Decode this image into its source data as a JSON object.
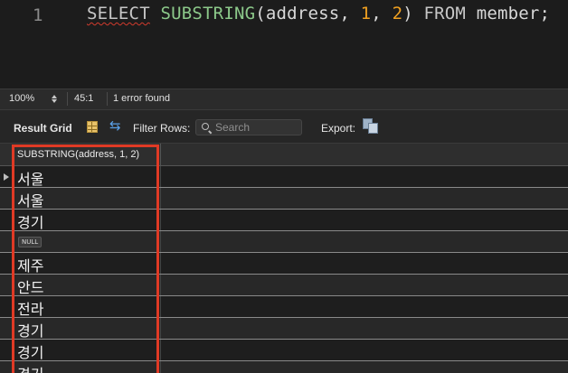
{
  "editor": {
    "line_number": "1",
    "tokens": {
      "select": "SELECT",
      "fn": "SUBSTRING",
      "open": "(",
      "arg": "address",
      "comma1": ", ",
      "n1": "1",
      "comma2": ", ",
      "n2": "2",
      "close": ")",
      "from": "FROM",
      "table": "member",
      "semi": ";"
    }
  },
  "status": {
    "zoom": "100%",
    "position": "45:1",
    "error_text": "1 error found"
  },
  "toolbar": {
    "result_grid_label": "Result Grid",
    "filter_rows_label": "Filter Rows:",
    "search_placeholder": "Search",
    "export_label": "Export:"
  },
  "grid": {
    "column_header": "SUBSTRING(address, 1, 2)",
    "rows": [
      {
        "value": "서울",
        "is_null": false
      },
      {
        "value": "서울",
        "is_null": false
      },
      {
        "value": "경기",
        "is_null": false
      },
      {
        "value": "NULL",
        "is_null": true
      },
      {
        "value": "제주",
        "is_null": false
      },
      {
        "value": "안드",
        "is_null": false
      },
      {
        "value": "전라",
        "is_null": false
      },
      {
        "value": "경기",
        "is_null": false
      },
      {
        "value": "경기",
        "is_null": false
      },
      {
        "value": "경기",
        "is_null": false
      }
    ]
  },
  "colors": {
    "highlight": "#e03a25",
    "keyword": "#c7c7c7",
    "function": "#8cc98a",
    "number": "#f0a020",
    "background": "#1e1e1e"
  },
  "icons": {
    "stepper": "stepper-icon",
    "grid": "grid-icon",
    "wrap": "wrap-cell-icon",
    "search": "search-icon",
    "export": "export-icon",
    "row_pointer": "row-pointer-icon"
  }
}
